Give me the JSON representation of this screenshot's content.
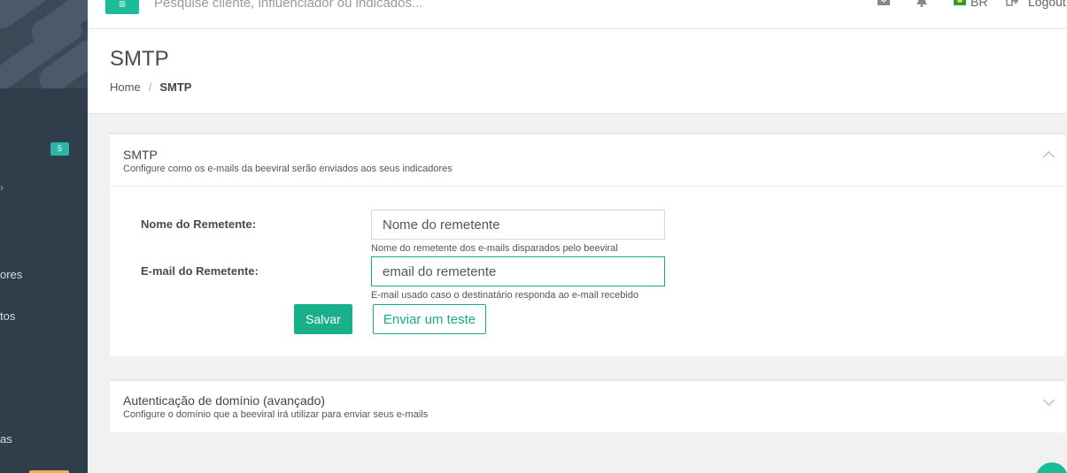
{
  "topbar": {
    "search_placeholder": "Pesquise cliente, influenciador ou indicados...",
    "language": "BR",
    "logout": "Logout"
  },
  "sidebar": {
    "badge": "5",
    "items": [
      "ores",
      "tos",
      "as"
    ]
  },
  "header": {
    "title": "SMTP",
    "breadcrumb": {
      "home": "Home",
      "separator": "/",
      "current": "SMTP"
    }
  },
  "smtp_panel": {
    "title": "SMTP",
    "subtitle": "Configure como os e-mails da beeviral serão enviados aos seus indicadores",
    "sender_name": {
      "label": "Nome do Remetente:",
      "placeholder": "Nome do remetente",
      "help": "Nome do remetente dos e-mails disparados pelo beeviral"
    },
    "sender_email": {
      "label": "E-mail do Remetente:",
      "placeholder": "email do remetente",
      "help": "E-mail usado caso o destinatário responda ao e-mail recebido"
    },
    "save_button": "Salvar",
    "test_button": "Enviar um teste"
  },
  "domain_panel": {
    "title": "Autenticação de domínio (avançado)",
    "subtitle": "Configure o domínio que a beeviral irá utilizar para enviar seus e-mails"
  },
  "colors": {
    "accent": "#1aaf8b",
    "sidebar": "#2f3e4a",
    "badge": "#2bb5a9"
  },
  "icons": [
    "menu-icon",
    "envelope-icon",
    "bell-icon",
    "brazil-flag-icon",
    "logout-icon",
    "chevron-up-icon",
    "chevron-down-icon"
  ]
}
